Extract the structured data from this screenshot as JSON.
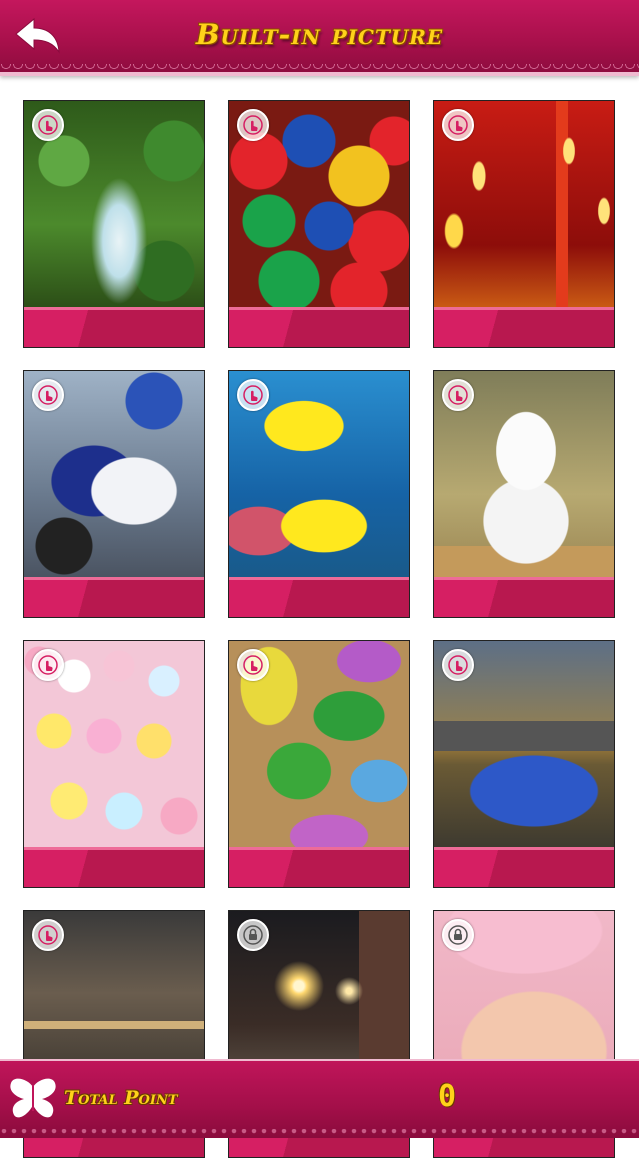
{
  "header": {
    "title": "Built-in picture",
    "back_icon": "back-arrow-icon"
  },
  "pictures": [
    {
      "name": "forest-stream",
      "status": "unlocked",
      "icon": "tap-hand-icon"
    },
    {
      "name": "candies",
      "status": "unlocked",
      "icon": "tap-hand-icon"
    },
    {
      "name": "christmas-candles",
      "status": "unlocked",
      "icon": "tap-hand-icon"
    },
    {
      "name": "motorcycle",
      "status": "unlocked",
      "icon": "tap-hand-icon"
    },
    {
      "name": "yellow-fish",
      "status": "unlocked",
      "icon": "tap-hand-icon"
    },
    {
      "name": "white-puppy",
      "status": "unlocked",
      "icon": "tap-hand-icon"
    },
    {
      "name": "sweets",
      "status": "unlocked",
      "icon": "tap-hand-icon"
    },
    {
      "name": "easter-eggs",
      "status": "unlocked",
      "icon": "tap-hand-icon"
    },
    {
      "name": "blue-car",
      "status": "unlocked",
      "icon": "tap-hand-icon"
    },
    {
      "name": "dirt-bike",
      "status": "unlocked",
      "icon": "tap-hand-icon"
    },
    {
      "name": "night-street",
      "status": "locked",
      "icon": "lock-icon"
    },
    {
      "name": "baby",
      "status": "locked",
      "icon": "lock-icon"
    }
  ],
  "footer": {
    "label": "Total Point",
    "value": "0",
    "icon": "butterfly-icon"
  },
  "colors": {
    "primary": "#b8184f",
    "accent": "#ffd21a",
    "band_light": "#d61f63"
  }
}
